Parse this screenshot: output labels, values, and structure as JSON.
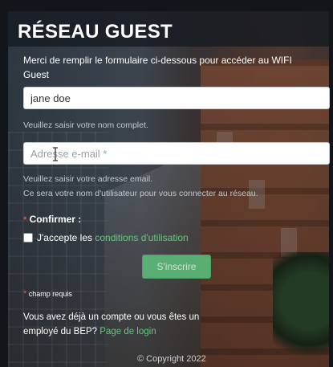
{
  "page": {
    "title": "RÉSEAU GUEST",
    "intro": "Merci de remplir le formulaire ci-dessous pour accéder au WIFI Guest"
  },
  "form": {
    "name_value": "jane doe",
    "name_help": "Veuillez saisir votre nom complet.",
    "email_placeholder": "Adresse e-mail *",
    "email_help_1": "Veuillez saisir votre adresse email.",
    "email_help_2": "Ce sera votre nom d'utilisateur pour vous connecter au réseau.",
    "required_star": "*",
    "confirm_label": "Confirmer :",
    "accept_prefix": "J'accepte les",
    "accept_link": "conditions d'utilisation",
    "submit_label": "S'inscrire",
    "required_note": "champ requis"
  },
  "footer": {
    "login_text": "Vous avez déjà un compte ou vous êtes un employé du BEP?",
    "login_link": "Page de login",
    "copyright": "© Copyright 2022"
  },
  "colors": {
    "accent_green": "#5cb878",
    "link_green": "#67c97d",
    "required_red": "#e0584a"
  },
  "icons": {
    "cursor": "text-cursor-icon"
  }
}
